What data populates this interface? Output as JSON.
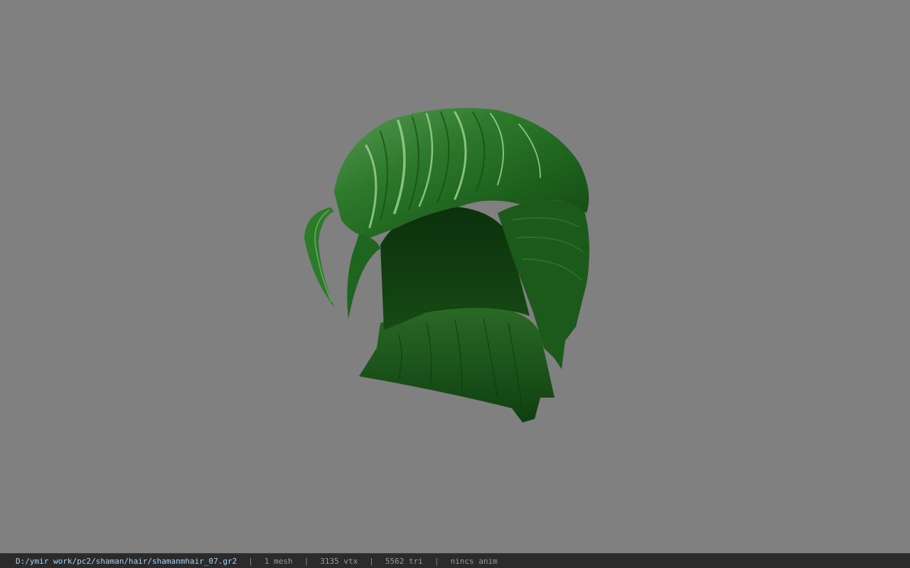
{
  "viewport": {
    "background_color": "#808080",
    "model_color": "#1f6a1f",
    "model_description_icon": "hair-mesh"
  },
  "statusbar": {
    "file_path": "D:/ymir work/pc2/shaman/hair/shamanmhair_07.gr2",
    "mesh_count": "1 mesh",
    "vertex_count": "3135 vtx",
    "triangle_count": "5562 tri",
    "anim_status": "nincs anim",
    "separator": "|",
    "path_color": "#a9d4f5"
  }
}
